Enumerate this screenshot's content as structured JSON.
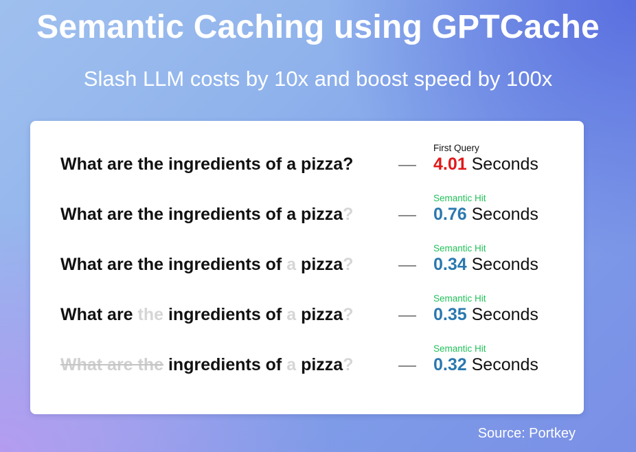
{
  "header": {
    "title": "Semantic Caching using GPTCache",
    "subtitle": "Slash LLM costs by 10x and boost speed by 100x"
  },
  "rows": [
    {
      "segments": [
        {
          "text": "What are the ingredients of a pizza?",
          "style": "normal"
        }
      ],
      "tag": "First Query",
      "tag_type": "first",
      "time": "4.01",
      "time_color": "red",
      "unit": " Seconds"
    },
    {
      "segments": [
        {
          "text": "What are the ingredients of a pizza",
          "style": "normal"
        },
        {
          "text": "?",
          "style": "faded"
        }
      ],
      "tag": "Semantic Hit",
      "tag_type": "hit",
      "time": "0.76",
      "time_color": "blue",
      "unit": " Seconds"
    },
    {
      "segments": [
        {
          "text": "What are the ingredients of ",
          "style": "normal"
        },
        {
          "text": "a",
          "style": "faded"
        },
        {
          "text": " pizza",
          "style": "normal"
        },
        {
          "text": "?",
          "style": "faded"
        }
      ],
      "tag": "Semantic Hit",
      "tag_type": "hit",
      "time": "0.34",
      "time_color": "blue",
      "unit": " Seconds"
    },
    {
      "segments": [
        {
          "text": "What are ",
          "style": "normal"
        },
        {
          "text": "the",
          "style": "faded"
        },
        {
          "text": " ingredients of ",
          "style": "normal"
        },
        {
          "text": "a",
          "style": "faded"
        },
        {
          "text": " pizza",
          "style": "normal"
        },
        {
          "text": "?",
          "style": "faded"
        }
      ],
      "tag": "Semantic Hit",
      "tag_type": "hit",
      "time": "0.35",
      "time_color": "blue",
      "unit": " Seconds"
    },
    {
      "segments": [
        {
          "text": "What are the",
          "style": "struck"
        },
        {
          "text": " ingredients of ",
          "style": "normal"
        },
        {
          "text": "a",
          "style": "faded"
        },
        {
          "text": " pizza",
          "style": "normal"
        },
        {
          "text": "?",
          "style": "faded"
        }
      ],
      "tag": "Semantic Hit",
      "tag_type": "hit",
      "time": "0.32",
      "time_color": "blue",
      "unit": " Seconds"
    }
  ],
  "footer": {
    "source": "Source: Portkey"
  },
  "colors": {
    "first_query_time": "#e01919",
    "semantic_hit_time": "#2a78b0",
    "semantic_hit_tag": "#22c05a",
    "faded_text": "#d6d6d6"
  }
}
